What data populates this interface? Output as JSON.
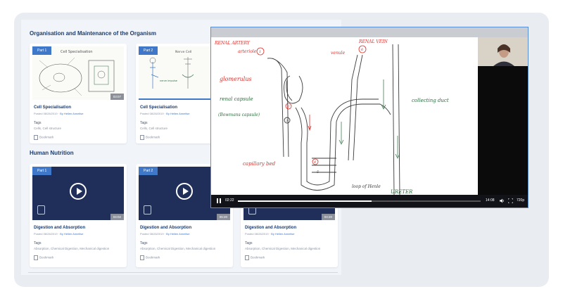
{
  "sections": [
    {
      "title": "Organisation and Maintenance of the Organism"
    },
    {
      "title": "Human Nutrition"
    }
  ],
  "cards": [
    {
      "part": "Part 1",
      "duration": "03:07",
      "title": "Cell Specialisation",
      "posted": "Posted 08/28/2019",
      "by": "By Hellen Annelise",
      "tags_label": "Tags",
      "tags": "Cells, Cell structure",
      "bookmark": "Bookmark"
    },
    {
      "part": "Part 2",
      "duration": "",
      "title": "Cell Specialisation",
      "posted": "Posted 08/28/2019",
      "by": "By Hellen Annelise",
      "tags_label": "Tags",
      "tags": "Cells, Cell structure",
      "bookmark": "Bookmark",
      "progress": 0.85
    },
    {
      "part": "Part 1",
      "duration": "04:02",
      "title": "Digestion and Absorption",
      "posted": "Posted 08/28/2019",
      "by": "By Hellen Annelise",
      "tags_label": "Tags",
      "tags": "Absorption, Chemical Digestion, Mechanical digestion",
      "bookmark": "Bookmark"
    },
    {
      "part": "Part 2",
      "duration": "06:20",
      "title": "Digestion and Absorption",
      "posted": "Posted 08/28/2019",
      "by": "By Hellen Annelise",
      "tags_label": "Tags",
      "tags": "Absorption, Chemical Digestion, Mechanical digestion",
      "bookmark": "Bookmark"
    },
    {
      "part": "",
      "duration": "04:20",
      "title": "Digestion and Absorption",
      "posted": "Posted 08/28/2019",
      "by": "By Hellen Annelise",
      "tags_label": "Tags",
      "tags": "Absorption, Chemical Digestion, Mechanical digestion",
      "bookmark": "Bookmark"
    }
  ],
  "player": {
    "current_time": "02:22",
    "total_time": "14:08",
    "quality": "720p",
    "progress": 0.55,
    "labels": {
      "renal_artery": "RENAL ARTERY",
      "arteriole": "arteriole",
      "renal_vein": "RENAL VEIN",
      "venule": "venule",
      "glomerulus": "glomerulus",
      "renal_capsule": "renal capsule",
      "bowmans_capsule": "(Bowmans capsule)",
      "collecting_duct": "collecting duct",
      "capillary_bed": "capillary bed",
      "loop_of_henle": "loop of Henle",
      "ureter": "URETER",
      "num1": "1",
      "num2": "2",
      "num3": "3",
      "num4": "4",
      "num5": "5",
      "num6": "6"
    }
  },
  "colors": {
    "accent": "#3f78c8",
    "heading": "#1c3c6e",
    "ink_red": "#d9302c",
    "ink_green": "#2c6b3d"
  }
}
